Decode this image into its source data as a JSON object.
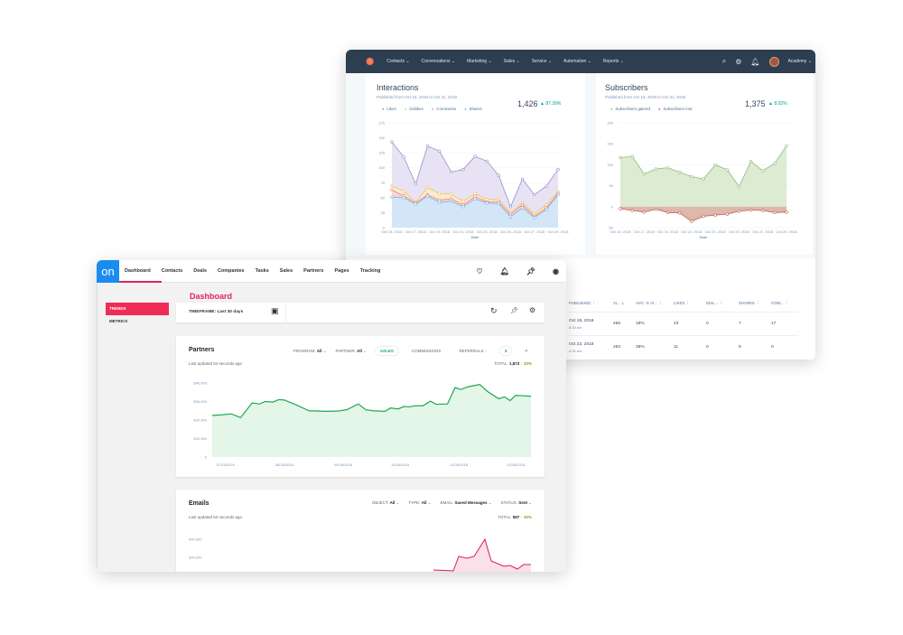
{
  "back_app": {
    "nav": {
      "items": [
        "Contacts ⌄",
        "Conversations ⌄",
        "Marketing ⌄",
        "Sales ⌄",
        "Service ⌄",
        "Automation ⌄",
        "Reports ⌄"
      ],
      "account": "Academy ⌄",
      "icons": [
        "search-icon",
        "gear-icon",
        "bell-icon"
      ]
    },
    "interactions": {
      "title": "Interactions",
      "subtitle": "Published from Oct 15, 2018 to Oct 31, 2018",
      "total": "1,426",
      "change": "▲ 87.39%"
    },
    "subscribers": {
      "title": "Subscribers",
      "subtitle": "Published from Oct 15, 2018 to Oct 31, 2018",
      "total": "1,375",
      "change": "▲ 8.02%"
    },
    "table": {
      "headers": [
        "PUBLISHED ⋮",
        "VI... ⇣",
        "AVG. % VI... ⋮",
        "LIKES ⋮",
        "DISL... ⋮",
        "SHARES ⋮",
        "COM... ⋮"
      ],
      "rows": [
        {
          "date": "Oct 15, 2018",
          "time": "8:30 am",
          "cells": [
            "465",
            "18%",
            "23",
            "0",
            "7",
            "17"
          ]
        },
        {
          "date": "Oct 22, 2018",
          "time": "8:30 am",
          "cells": [
            "283",
            "38%",
            "11",
            "0",
            "6",
            "0"
          ]
        }
      ]
    }
  },
  "front_app": {
    "logo": "on",
    "nav": {
      "items": [
        "Dashboard",
        "Contacts",
        "Deals",
        "Companies",
        "Tasks",
        "Sales",
        "Partners",
        "Pages",
        "Tracking"
      ],
      "active": "Dashboard",
      "icons": [
        "heart-icon",
        "bell-icon",
        "pin-icon",
        "account-icon"
      ]
    },
    "sidebar": {
      "items": [
        "TRENDS",
        "METRICS"
      ],
      "active": "TRENDS"
    },
    "page_title": "Dashboard",
    "timeframe": "TIMEFRAME: Last 30 days",
    "partners": {
      "title": "Partners",
      "updated": "Last updated 54 seconds ago",
      "filters": [
        {
          "label": "PROGRAM:",
          "value": "All"
        },
        {
          "label": "PARTNER:",
          "value": "All"
        }
      ],
      "tabs": [
        "SALES",
        "COMMISSIONS",
        "REFERRALS"
      ],
      "active_tab": "SALES",
      "referrals_badge": "↑",
      "units": [
        "$",
        "#"
      ],
      "active_unit": "$",
      "total_label": "TOTAL:",
      "total": "1,873",
      "change": "↑ 30%"
    },
    "emails": {
      "title": "Emails",
      "updated": "Last updated 54 seconds ago",
      "filters": [
        {
          "label": "OBJECT:",
          "value": "All"
        },
        {
          "label": "TYPE:",
          "value": "All"
        },
        {
          "label": "EMAIL:",
          "value": "Saved Messages"
        },
        {
          "label": "STATUS:",
          "value": "Sent"
        }
      ],
      "total_label": "TOTAL:",
      "total": "587",
      "change": "↑ 30%"
    }
  },
  "chart_data": [
    {
      "id": "interactions",
      "type": "area",
      "xlabel": "Date",
      "ylim": [
        0,
        175
      ],
      "yticks": [
        0,
        25,
        50,
        75,
        100,
        125,
        150,
        175
      ],
      "x": [
        "Oct 15, 2018",
        "Oct 16, 2018",
        "Oct 17, 2018",
        "Oct 18, 2018",
        "Oct 19, 2018",
        "Oct 20, 2018",
        "Oct 21, 2018",
        "Oct 22, 2018",
        "Oct 23, 2018",
        "Oct 24, 2018",
        "Oct 25, 2018",
        "Oct 26, 2018",
        "Oct 27, 2018",
        "Oct 28, 2018",
        "Oct 29, 2018"
      ],
      "xticks": [
        "Oct 15, 2018",
        "Oct 17, 2018",
        "Oct 19, 2018",
        "Oct 21, 2018",
        "Oct 23, 2018",
        "Oct 25, 2018",
        "Oct 27, 2018",
        "Oct 29, 2018"
      ],
      "legend_position": "top-left",
      "series": [
        {
          "name": "Likes",
          "color": "#9a8fc8",
          "fill": "#e8e3f4",
          "values": [
            143,
            118,
            73,
            136,
            128,
            93,
            97,
            119,
            111,
            87,
            35,
            81,
            55,
            69,
            97
          ]
        },
        {
          "name": "Dislikes",
          "color": "#f0c15f",
          "fill": "#fbeccd",
          "values": [
            70,
            61,
            42,
            67,
            57,
            56,
            44,
            57,
            47,
            47,
            25,
            41,
            23,
            38,
            60
          ]
        },
        {
          "name": "Comments",
          "color": "#ec8585",
          "fill": "#f8d6d6",
          "values": [
            63,
            53,
            41,
            55,
            46,
            48,
            38,
            52,
            43,
            43,
            22,
            38,
            19,
            33,
            57
          ]
        },
        {
          "name": "Shares",
          "color": "#7fb0e3",
          "fill": "#d3e6f7",
          "values": [
            51,
            50,
            39,
            53,
            42,
            44,
            35,
            48,
            41,
            40,
            18,
            33,
            17,
            30,
            55
          ]
        }
      ]
    },
    {
      "id": "subscribers",
      "type": "area",
      "xlabel": "Date",
      "ylim": [
        -50,
        200
      ],
      "yticks": [
        -50,
        0,
        50,
        100,
        150,
        200
      ],
      "x": [
        "Oct 15, 2018",
        "Oct 16, 2018",
        "Oct 17, 2018",
        "Oct 18, 2018",
        "Oct 19, 2018",
        "Oct 20, 2018",
        "Oct 21, 2018",
        "Oct 22, 2018",
        "Oct 23, 2018",
        "Oct 24, 2018",
        "Oct 25, 2018",
        "Oct 26, 2018",
        "Oct 27, 2018",
        "Oct 28, 2018",
        "Oct 29, 2018"
      ],
      "xticks": [
        "Oct 15, 2018",
        "Oct 17, 2018",
        "Oct 19, 2018",
        "Oct 21, 2018",
        "Oct 23, 2018",
        "Oct 25, 2018",
        "Oct 27, 2018",
        "Oct 29, 2018"
      ],
      "legend_position": "top-left",
      "series": [
        {
          "name": "Subscribers gained",
          "color": "#8dbd78",
          "fill": "#dcebd2",
          "values": [
            117,
            120,
            78,
            90,
            93,
            82,
            72,
            66,
            100,
            88,
            48,
            108,
            86,
            103,
            145
          ]
        },
        {
          "name": "Subscribers lost",
          "color": "#bf6258",
          "fill": "#dcb9aa",
          "values": [
            -5,
            -9,
            -13,
            -6,
            -14,
            -15,
            -35,
            -23,
            -20,
            -18,
            -11,
            -8,
            -9,
            -14,
            -13
          ]
        }
      ]
    },
    {
      "id": "partners",
      "type": "area",
      "ylim": [
        0,
        40000
      ],
      "yticks": [
        "0",
        "$10,000",
        "$20,000",
        "$30,000",
        "$40,000"
      ],
      "xticks": [
        "07/28/2018",
        "08/28/2018",
        "09/28/2018",
        "10/28/2018",
        "11/28/2018",
        "12/28/2018"
      ],
      "color": "#1fa84f",
      "fill": "#e3f6e8",
      "points": [
        [
          "2018-07-21",
          22500
        ],
        [
          "2018-07-26",
          22800
        ],
        [
          "2018-07-31",
          23300
        ],
        [
          "2018-08-05",
          21300
        ],
        [
          "2018-08-11",
          29200
        ],
        [
          "2018-08-15",
          28700
        ],
        [
          "2018-08-18",
          30000
        ],
        [
          "2018-08-22",
          29700
        ],
        [
          "2018-08-25",
          31000
        ],
        [
          "2018-08-28",
          30800
        ],
        [
          "2018-09-03",
          28300
        ],
        [
          "2018-09-10",
          25000
        ],
        [
          "2018-09-19",
          24700
        ],
        [
          "2018-09-25",
          24800
        ],
        [
          "2018-09-30",
          25600
        ],
        [
          "2018-10-06",
          28700
        ],
        [
          "2018-10-10",
          25500
        ],
        [
          "2018-10-14",
          25000
        ],
        [
          "2018-10-20",
          24700
        ],
        [
          "2018-10-23",
          26500
        ],
        [
          "2018-10-27",
          26000
        ],
        [
          "2018-10-30",
          27300
        ],
        [
          "2018-11-02",
          27100
        ],
        [
          "2018-11-05",
          27700
        ],
        [
          "2018-11-09",
          27700
        ],
        [
          "2018-11-13",
          30200
        ],
        [
          "2018-11-16",
          28500
        ],
        [
          "2018-11-22",
          28700
        ],
        [
          "2018-11-26",
          37500
        ],
        [
          "2018-11-29",
          36500
        ],
        [
          "2018-12-03",
          38000
        ],
        [
          "2018-12-09",
          39200
        ],
        [
          "2018-12-13",
          35500
        ],
        [
          "2018-12-19",
          31500
        ],
        [
          "2018-12-22",
          32500
        ],
        [
          "2018-12-25",
          30500
        ],
        [
          "2018-12-28",
          33300
        ],
        [
          "2018-12-31",
          33200
        ],
        [
          "2019-01-05",
          32800
        ]
      ]
    },
    {
      "id": "emails",
      "type": "area",
      "yticks": [
        "300,000",
        "400,000"
      ],
      "color": "#d81b5a",
      "fill": "#fbe0e7",
      "values": [
        230000,
        225000,
        305000,
        295000,
        305000,
        400000,
        280000,
        250000,
        255000,
        235000,
        260000,
        260000
      ]
    }
  ]
}
